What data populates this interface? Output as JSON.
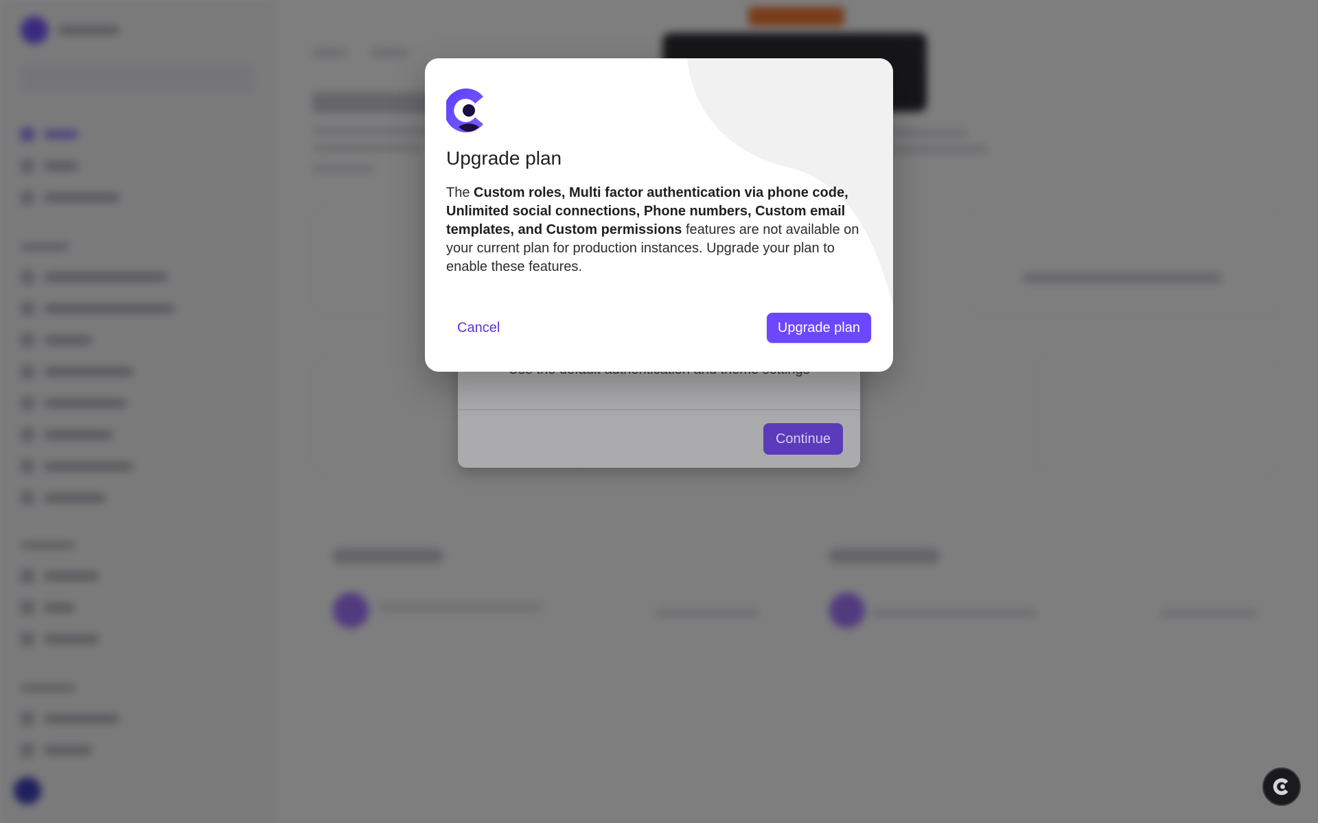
{
  "modal": {
    "title": "Upgrade plan",
    "body_prefix": "The ",
    "body_features": "Custom roles, Multi factor authentication via phone code, Unlimited social connections, Phone numbers, Custom email templates, and Custom permissions",
    "body_suffix": " features are not available on your current plan for production instances. Upgrade your plan to enable these features.",
    "cancel_label": "Cancel",
    "upgrade_label": "Upgrade plan",
    "logo_icon": "clerk-logo-icon"
  },
  "back_dialog": {
    "description": "Use the default authentication and theme settings",
    "continue_label": "Continue"
  },
  "help_button": {
    "icon": "clerk-logo-icon"
  },
  "colors": {
    "accent": "#6c47ff",
    "link": "#5b32d8",
    "overlay": "rgba(20,20,22,0.55)"
  }
}
